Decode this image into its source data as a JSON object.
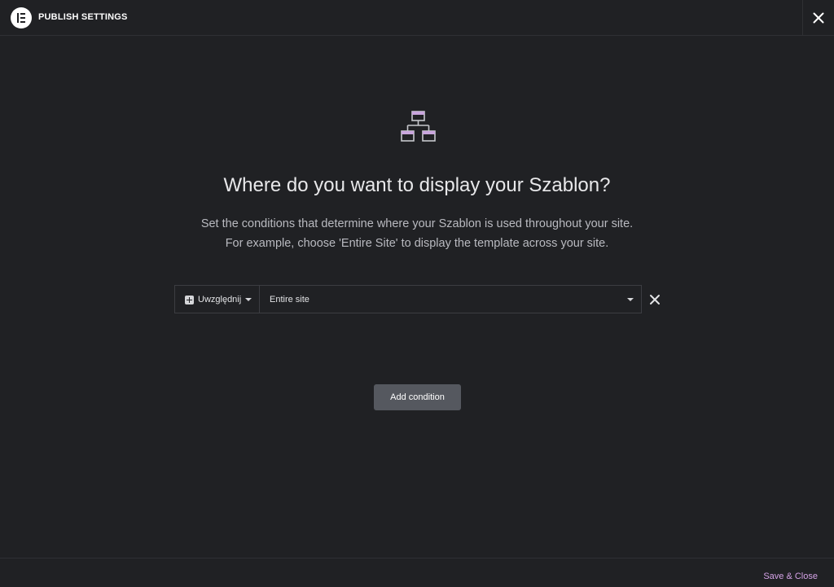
{
  "header": {
    "title": "PUBLISH SETTINGS",
    "logo_icon": "elementor-logo-icon",
    "close_icon": "close-icon"
  },
  "main": {
    "icon": "sitemap-icon",
    "icon_color": "#c9a6dd",
    "title": "Where do you want to display your Szablon?",
    "description_line1": "Set the conditions that determine where your Szablon is used throughout your site.",
    "description_line2": "For example, choose 'Entire Site' to display the template across your site."
  },
  "condition": {
    "type_label": "Uwzględnij",
    "type_icon": "plus-square-icon",
    "value": "Entire site",
    "remove_icon": "close-icon"
  },
  "add_condition_label": "Add condition",
  "footer": {
    "save_label": "Save & Close",
    "accent": "#d4a2e6"
  }
}
